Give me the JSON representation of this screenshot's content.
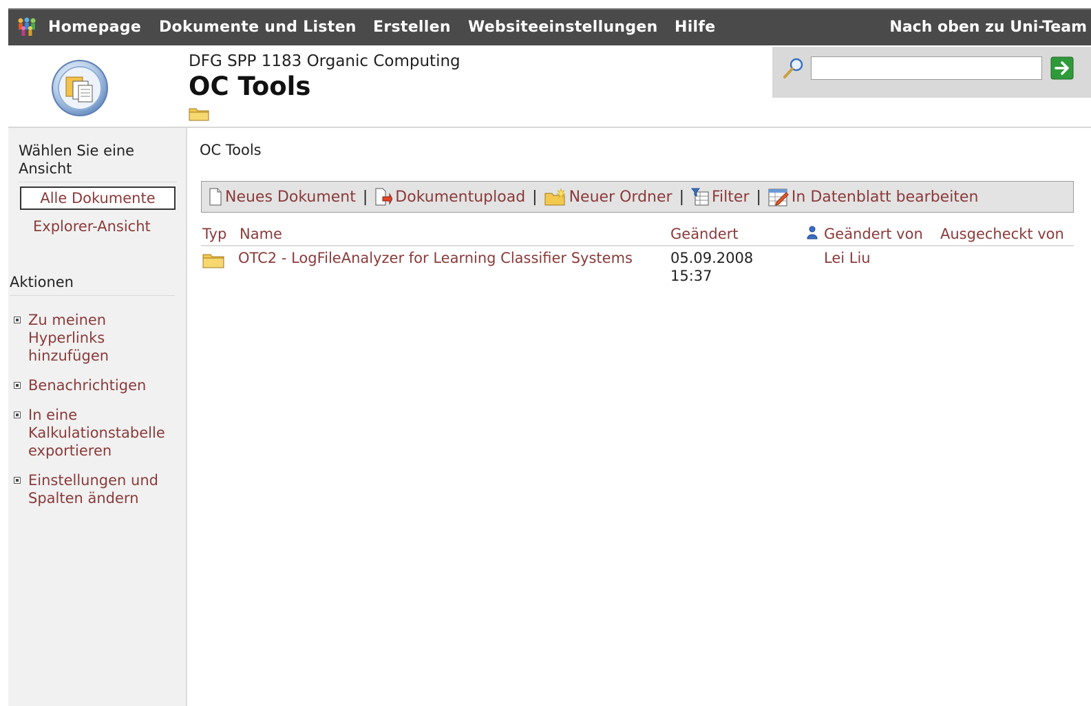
{
  "topbar": {
    "nav": [
      "Homepage",
      "Dokumente und Listen",
      "Erstellen",
      "Websiteeinstellungen",
      "Hilfe"
    ],
    "up_link": "Nach oben zu Uni-Team"
  },
  "header": {
    "site_subtitle": "DFG SPP 1183 Organic Computing",
    "page_title": "OC Tools",
    "search": {
      "value": "",
      "placeholder": ""
    }
  },
  "sidebar": {
    "views_title": "Wählen Sie eine Ansicht",
    "views": [
      "Alle Dokumente",
      "Explorer-Ansicht"
    ],
    "actions_title": "Aktionen",
    "actions": [
      "Zu meinen Hyperlinks hinzufügen",
      "Benachrichtigen",
      "In eine Kalkulationstabelle exportieren",
      "Einstellungen und Spalten ändern"
    ]
  },
  "main": {
    "breadcrumb": "OC Tools",
    "toolbar": {
      "new_document": "Neues Dokument",
      "upload": "Dokumentupload",
      "new_folder": "Neuer Ordner",
      "filter": "Filter",
      "datasheet": "In Datenblatt bearbeiten"
    },
    "columns": [
      "Typ",
      "Name",
      "Geändert",
      "Geändert von",
      "Ausgecheckt von"
    ],
    "rows": [
      {
        "type": "folder-icon",
        "name": "OTC2 - LogFileAnalyzer for Learning Classifier Systems",
        "modified_date": "05.09.2008",
        "modified_time": "15:37",
        "modified_by": "Lei Liu",
        "checked_out_by": ""
      }
    ]
  },
  "colors": {
    "topbar_bg": "#4a4a4a",
    "link": "#8b3a3a",
    "sidebar_bg": "#f1f1f1",
    "toolbar_bg": "#e3e3e3",
    "search_panel_bg": "#d9d9d9"
  }
}
